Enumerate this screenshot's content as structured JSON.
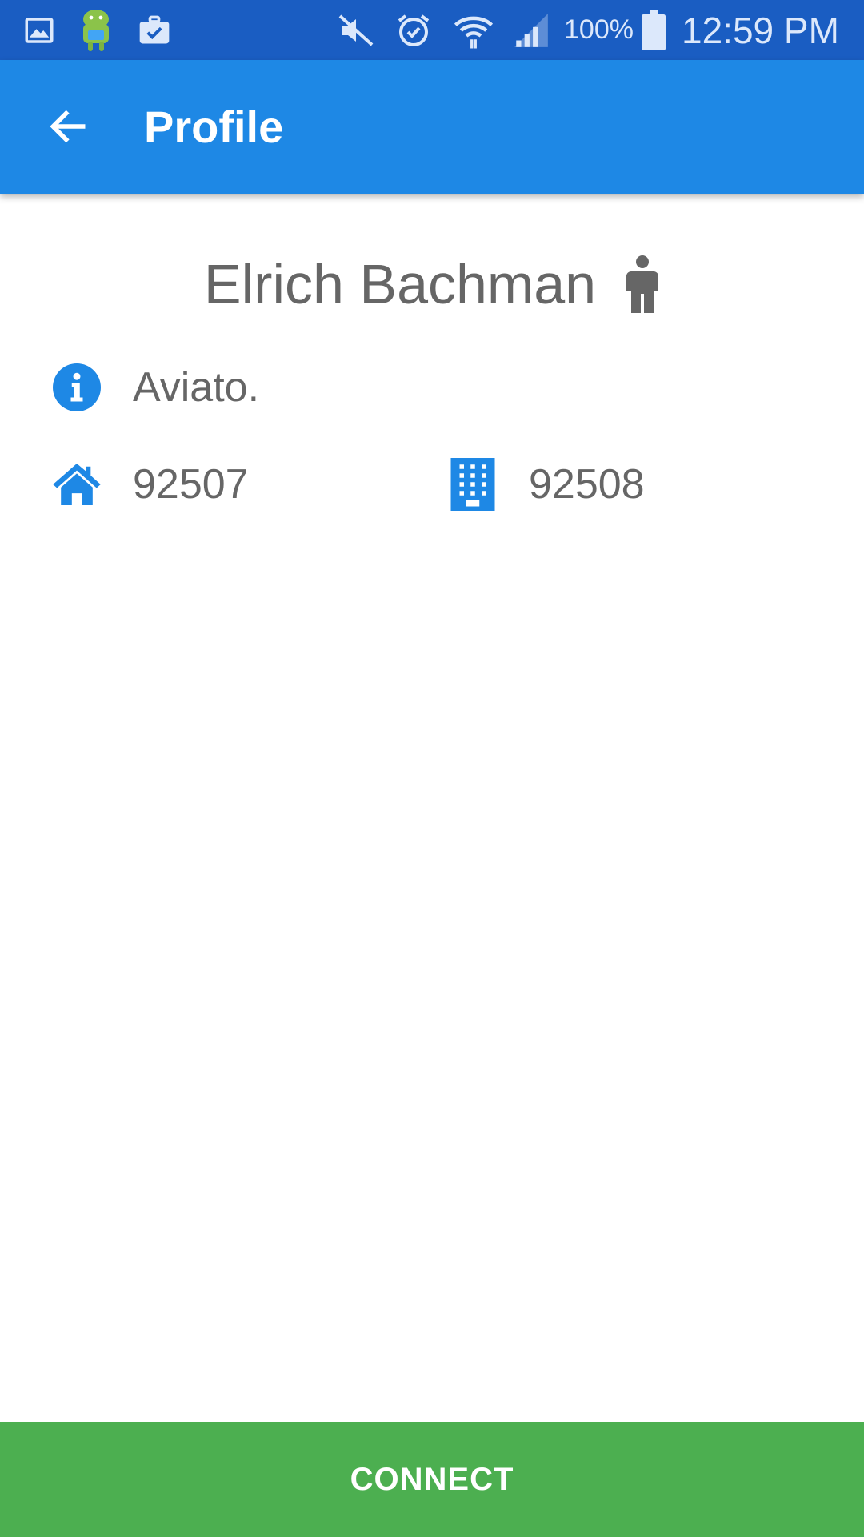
{
  "colors": {
    "status_bar": "#1a5dc2",
    "app_bar": "#1e88e5",
    "accent_icon": "#1e88e5",
    "connect_button": "#4caf50",
    "text_gray": "#666666"
  },
  "status_bar": {
    "left_icons": [
      "gallery-icon",
      "android-app-icon",
      "briefcase-check-icon"
    ],
    "right_icons": [
      "mute-icon",
      "alarm-icon",
      "wifi-icon",
      "signal-icon",
      "battery-icon"
    ],
    "battery": "100%",
    "time": "12:59 PM"
  },
  "app_bar": {
    "back_icon": "arrow-back-icon",
    "title": "Profile"
  },
  "profile": {
    "name": "Elrich Bachman",
    "gender_icon": "male-icon",
    "company_icon": "info-icon",
    "company": "Aviato.",
    "home_icon": "home-icon",
    "home_zip": "92507",
    "work_icon": "building-icon",
    "work_zip": "92508"
  },
  "actions": {
    "connect_label": "CONNECT"
  }
}
